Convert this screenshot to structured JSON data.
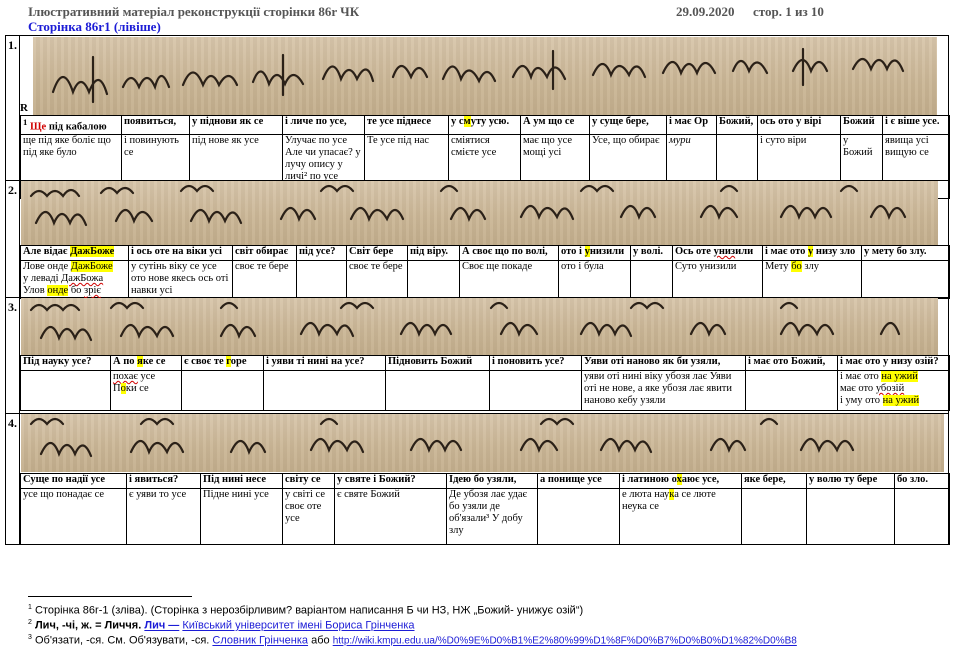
{
  "header": {
    "title": "Ілюстративний матеріал  реконструкції сторінки 86r ЧК",
    "date": "29.09.2020",
    "page_info": "стор. 1 из 10",
    "subtitle": "Сторінка 86r1 (лівіше)"
  },
  "sections": [
    {
      "number": "1.",
      "marker": "R",
      "manuscript_alt": "фрагмент рукопису, рядок 1",
      "headers": [
        "¹ Ще під кабалою",
        "появиться,",
        "у піднови як се",
        "і личе по усе,",
        "те усе піднесе",
        "у смуту усю.",
        "А ум що се",
        "у суще бере,",
        "і має Ор",
        "Божий,",
        "ось ото у вірі",
        "Божий",
        "і є віше усе."
      ],
      "cells": [
        "ще під яке болiє що під яке було",
        "і повинують се",
        "під нове як усе",
        "Улучає по усе Але чи упасає? у лучу опису у личі² по усе",
        "Те усе під нас",
        "смiятися смiєте усе",
        "має що усе мощі усі",
        "Усе, що обирає",
        "мури",
        "",
        "і суто віри",
        "у Божий",
        "явища усі вищую се"
      ]
    },
    {
      "number": "2.",
      "headers": [
        "Але відає ДажБоже",
        "і ось оте на віки усі",
        "світ обирає",
        "під усе?",
        "Світ бере",
        "під віру.",
        "А своє що по волі,",
        "ото і унизили",
        "у волі.",
        "Ось оте униз​или",
        "і має ото у низу зло",
        "у мету бо злу."
      ],
      "cells": [
        "Лове онде ДажБоже у левадi ДажБожа Улов онде бо зріє",
        "у сутінь віку се усе ото нове якесь ось оті навки усі",
        "своє те бере",
        "",
        "своє те бере",
        "",
        "Своє ще покаде",
        "ото і була",
        "",
        "Суто унизили",
        "Мету бо злу",
        ""
      ]
    },
    {
      "number": "3.",
      "headers": [
        "Під науку усе?",
        "А по яке се",
        "є своє те горе",
        "і уяви ті нині на усе?",
        "Підновить Божий",
        "і поновить усе?",
        "Уяви оті наново як би узяли,",
        "і має ото Божий,",
        "і має ото у низу озій?"
      ],
      "cells": [
        "",
        "похає усе Поки се",
        "",
        "",
        "",
        "",
        "уяви оті нині віку убозя лає Уяви оті не нове, а яке убозя лає явити наново кебу узяли",
        "",
        "і має ото на ужий має ото убозій і уму ото на ужий"
      ]
    },
    {
      "number": "4.",
      "headers": [
        "Суще по надії усе",
        "і явиться?",
        "Під нині несе",
        "світу се",
        "у святе і Божий?",
        "Ідею бо узяли,",
        "а понище усе",
        "і латиною охаює усе,",
        "яке бере,",
        "у волю ту бере",
        "бо зло."
      ],
      "cells": [
        "усе що понадає се",
        "є уяви то усе",
        "Підне нині усе",
        "у світі се своє оте усе",
        "є святе Божий",
        "Де убозя лає удає бо узяли де об'язали³ У добу злу",
        "",
        "е люта наука се люте неука се",
        "",
        "",
        ""
      ]
    }
  ],
  "footnotes": [
    {
      "num": "1",
      "text": "Сторінка 86r-1 (зліва). (Сторінка з нерозбірливим? варіантом написання Б чи НЗ, НЖ „Божий- унижує озій“)"
    },
    {
      "num": "2",
      "term": "Лич, -чі, ж. = Личчя.",
      "src_label": "Лич —",
      "src": "Київський університет імені Бориса Грінченка"
    },
    {
      "num": "3",
      "term": "Об'язати, -ся. См. Об'язувати, -ся.",
      "src": "Словник Грінченка",
      "sep": "або",
      "url": "http://wiki.kmpu.edu.ua/%D0%9E%D0%B1%E2%80%99%D1%8F%D0%B7%D0%B0%D1%82%D0%B8"
    }
  ],
  "colors": {
    "highlight": "#ffff00",
    "link": "#1c1cd6",
    "parchment": "#cdb998",
    "ink": "#2b2118"
  }
}
